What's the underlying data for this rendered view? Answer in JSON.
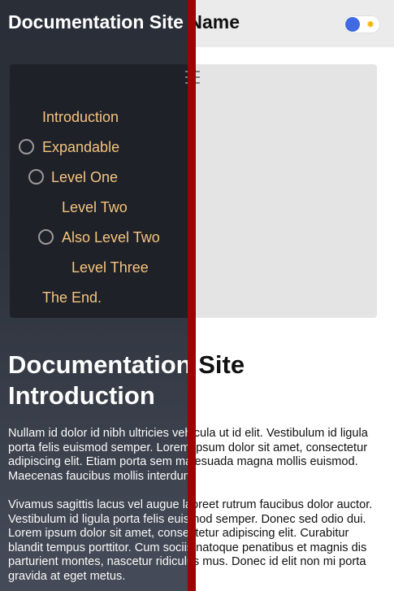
{
  "header": {
    "site_title": "Documentation Site Name"
  },
  "theme_toggle": {
    "knob_color": "#4169e1",
    "icon": "sun-icon",
    "icon_glyph": "✹"
  },
  "sidebar": {
    "menu_icon": "hamburger-icon",
    "items": [
      {
        "label": "Introduction",
        "expandable": false
      },
      {
        "label": "Expandable",
        "expandable": true
      },
      {
        "label": "Level One",
        "expandable": true
      },
      {
        "label": "Level Two",
        "expandable": false
      },
      {
        "label": "Also Level Two",
        "expandable": true
      },
      {
        "label": "Level Three",
        "expandable": false
      },
      {
        "label": "The End.",
        "expandable": false
      }
    ]
  },
  "main": {
    "heading": "Documentation Site Introduction",
    "paragraphs": [
      "Nullam id dolor id nibh ultricies vehicula ut id elit. Vestibulum id ligula porta felis euismod semper. Lorem ipsum dolor sit amet, consectetur adipiscing elit. Etiam porta sem malesuada magna mollis euismod. Maecenas faucibus mollis interdum.",
      "Vivamus sagittis lacus vel augue laoreet rutrum faucibus dolor auctor. Vestibulum id ligula porta felis euismod semper. Donec sed odio dui. Lorem ipsum dolor sit amet, consectetur adipiscing elit. Curabitur blandit tempus porttitor. Cum sociis natoque penatibus et magnis dis parturient montes, nascetur ridiculus mus. Donec id elit non mi porta gravida at eget metus."
    ]
  },
  "colors": {
    "panel_dark": "#1e2128",
    "menu_link": "#f5c47f",
    "divider": "#a00000"
  }
}
